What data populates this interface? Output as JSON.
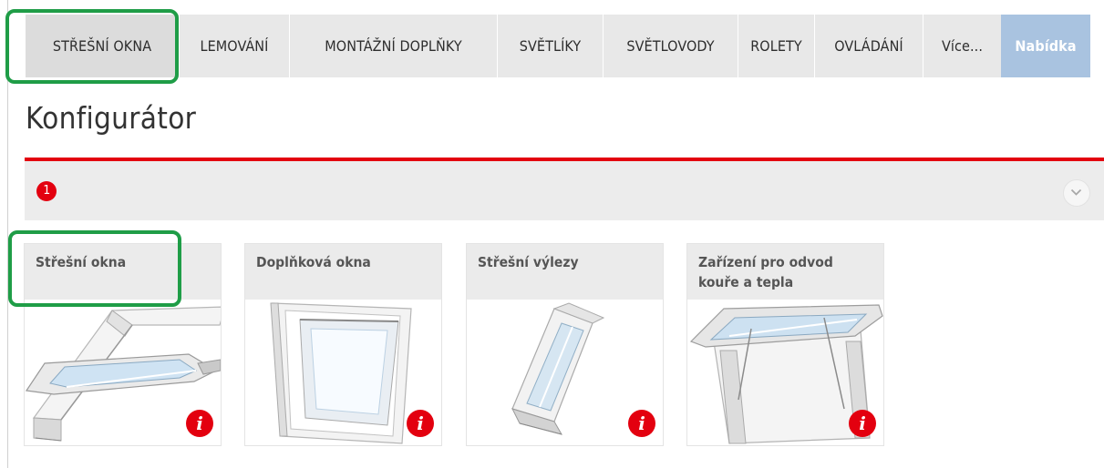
{
  "nav": {
    "items": [
      {
        "label": "STŘEŠNÍ OKNA"
      },
      {
        "label": "LEMOVÁNÍ"
      },
      {
        "label": "MONTÁŽNÍ DOPLŇKY"
      },
      {
        "label": "SVĚTLÍKY"
      },
      {
        "label": "SVĚTLOVODY"
      },
      {
        "label": "ROLETY"
      },
      {
        "label": "OVLÁDÁNÍ"
      },
      {
        "label": "Více..."
      }
    ],
    "offer_label": "Nabídka"
  },
  "page": {
    "title": "Konfigurátor"
  },
  "step": {
    "number": "1"
  },
  "categories": [
    {
      "title": "Střešní okna",
      "info": "i"
    },
    {
      "title": "Doplňková okna",
      "info": "i"
    },
    {
      "title": "Střešní výlezy",
      "info": "i"
    },
    {
      "title": "Zařízení pro odvod kouře a tepla",
      "info": "i"
    }
  ],
  "colors": {
    "accent_red": "#e3000f",
    "offer_blue": "#a9c3e0",
    "highlight_green": "#1f9d47",
    "nav_bg": "#e8e8e8"
  },
  "icons": [
    "chevron-down-icon",
    "info-icon"
  ]
}
